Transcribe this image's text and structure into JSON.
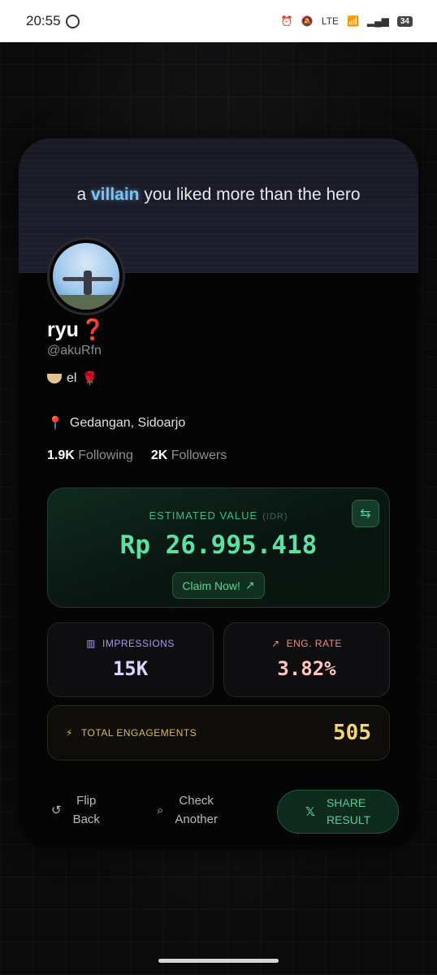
{
  "status_bar": {
    "time": "20:55",
    "battery": "34"
  },
  "banner": {
    "prefix": "a",
    "highlight": "villain",
    "suffix": "you liked more than the hero"
  },
  "profile": {
    "name": "ryu",
    "name_emoji": "❓",
    "handle": "@akuRfn",
    "bio": "el",
    "location": "Gedangan, Sidoarjo",
    "following_count": "1.9K",
    "following_label": "Following",
    "followers_count": "2K",
    "followers_label": "Followers"
  },
  "estimate": {
    "label": "ESTIMATED VALUE",
    "unit": "(IDR)",
    "value": "Rp 26.995.418",
    "claim_label": "Claim Now!"
  },
  "stats": {
    "impressions_label": "IMPRESSIONS",
    "impressions_value": "15K",
    "eng_label": "ENG. RATE",
    "eng_value": "3.82%",
    "total_label": "TOTAL ENGAGEMENTS",
    "total_value": "505"
  },
  "actions": {
    "flip_line1": "Flip",
    "flip_line2": "Back",
    "check_line1": "Check",
    "check_line2": "Another",
    "share_line1": "SHARE",
    "share_line2": "RESULT"
  },
  "colors": {
    "accent_green": "#5fe0a3",
    "impressions": "#a79cf0",
    "engagement": "#f08a8a",
    "total": "#f7d474"
  }
}
